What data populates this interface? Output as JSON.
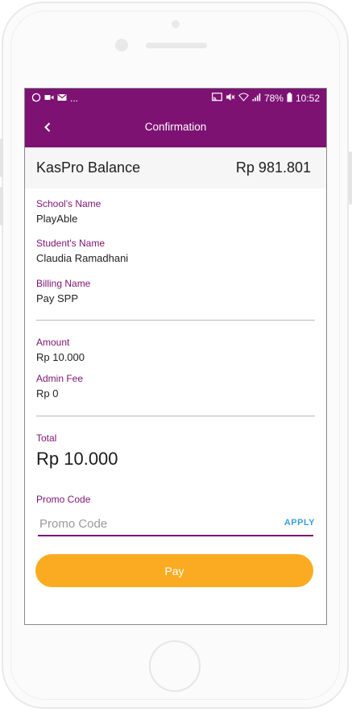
{
  "statusbar": {
    "left_icons": [
      "whatsapp-icon",
      "video-icon",
      "mail-icon"
    ],
    "left_more": "...",
    "battery": "78%",
    "time": "10:52"
  },
  "appbar": {
    "title": "Confirmation"
  },
  "balance": {
    "label": "KasPro Balance",
    "amount": "Rp 981.801"
  },
  "details": {
    "school_label": "School's Name",
    "school_value": "PlayAble",
    "student_label": "Student's Name",
    "student_value": "Claudia Ramadhani",
    "billing_label": "Billing Name",
    "billing_value": "Pay SPP"
  },
  "charges": {
    "amount_label": "Amount",
    "amount_value": "Rp 10.000",
    "fee_label": "Admin Fee",
    "fee_value": "Rp 0"
  },
  "total": {
    "label": "Total",
    "value": "Rp 10.000"
  },
  "promo": {
    "label": "Promo Code",
    "placeholder": "Promo Code",
    "value": "",
    "apply_label": "APPLY"
  },
  "pay_button": {
    "label": "Pay"
  },
  "colors": {
    "primary": "#7d1273",
    "accent": "#fbab21",
    "link": "#3aa0d8"
  }
}
